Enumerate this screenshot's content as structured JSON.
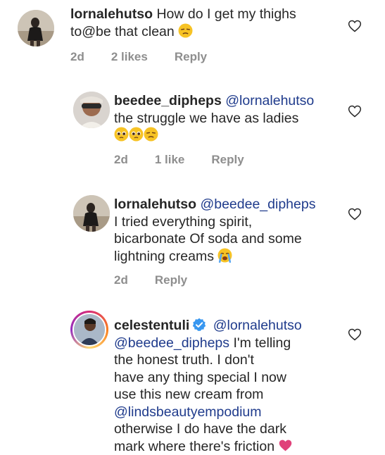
{
  "comments": [
    {
      "username": "lornalehutso",
      "text_1": "How do I get my thighs",
      "text_2": "to@be that clean",
      "emoji": "unamused-face",
      "time": "2d",
      "likes": "2 likes",
      "reply": "Reply"
    },
    {
      "username": "beedee_dipheps",
      "mention": "@lornalehutso",
      "text_1": "the struggle we have as ladies",
      "emojis": [
        "pleading-face",
        "pleading-face",
        "unamused-face"
      ],
      "time": "2d",
      "likes": "1 like",
      "reply": "Reply"
    },
    {
      "username": "lornalehutso",
      "mention": "@beedee_dipheps",
      "text_1": "I tried everything spirit,",
      "text_2": "bicarbonate Of soda and some",
      "text_3": "lightning creams",
      "emoji": "loudly-crying-face",
      "time": "2d",
      "reply": "Reply"
    },
    {
      "username": "celestentuli",
      "verified": true,
      "mention_1": "@lornalehutso",
      "mention_2": "@beedee_dipheps",
      "text_1": "I'm telling",
      "text_2": "the honest truth. I don't",
      "text_3": "have any thing special I now",
      "text_4": "use this new cream from",
      "mention_3": "@lindsbeautyempodium",
      "text_5": "otherwise I do have the dark",
      "text_6": "mark where there's friction"
    }
  ],
  "colors": {
    "mention": "#1f3b8c",
    "meta": "#8e8e8e",
    "verified": "#3897f0"
  }
}
